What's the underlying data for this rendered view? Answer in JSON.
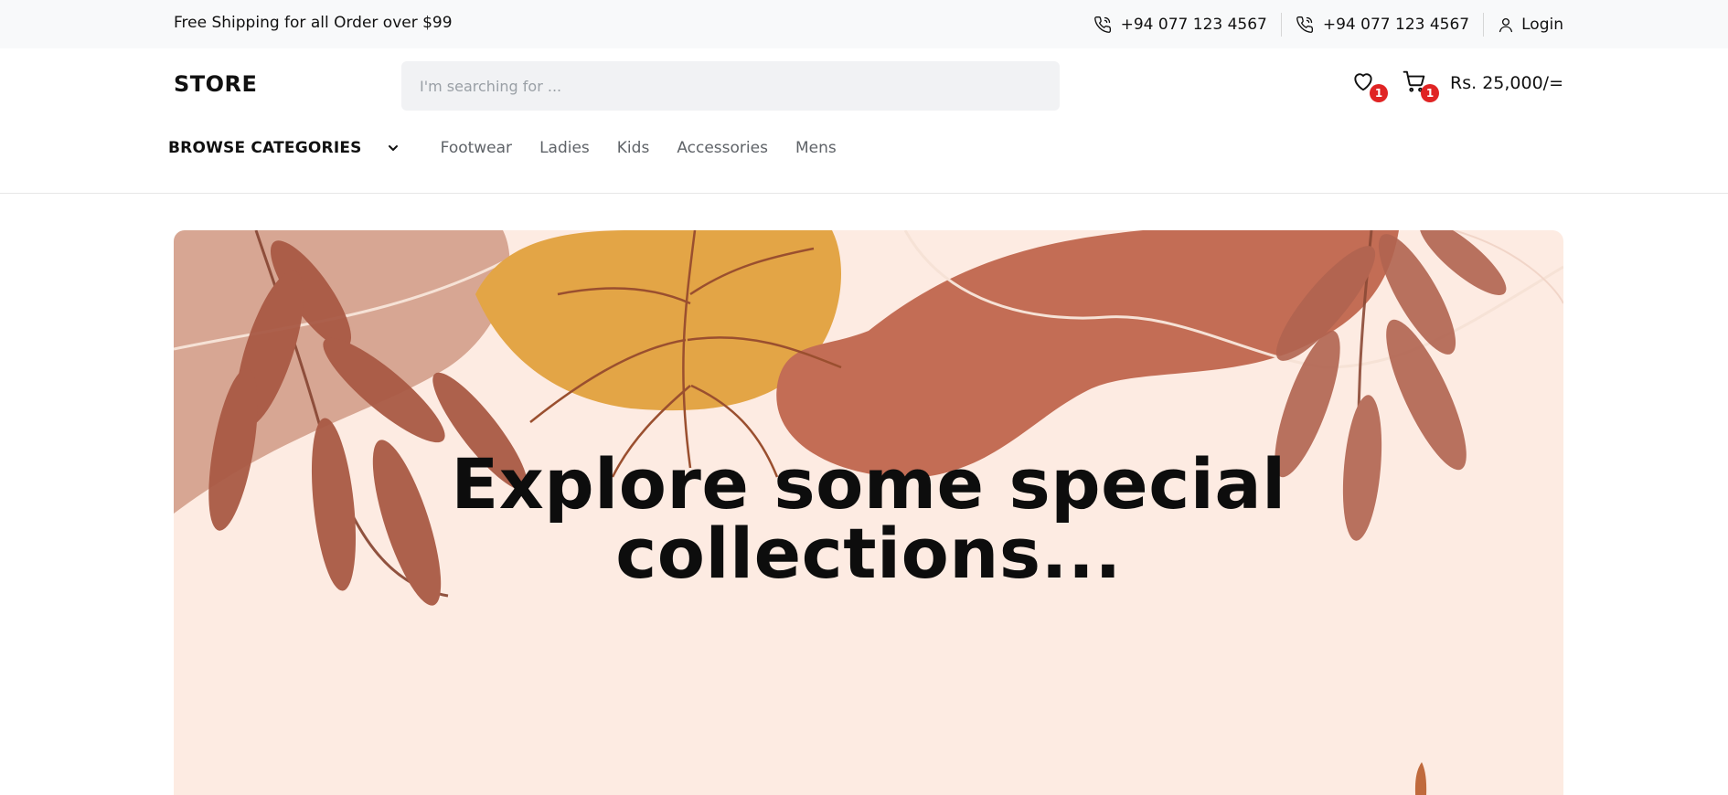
{
  "topbar": {
    "promo_text": "Free Shipping for all Order over $99",
    "phones": [
      "+94 077 123 4567",
      "+94 077 123 4567"
    ],
    "phone_icon": "phone-icon",
    "login_label": "Login",
    "login_icon": "user-icon"
  },
  "header": {
    "logo": "STORE",
    "search_placeholder": "I'm searching for ...",
    "wishlist_icon": "heart-icon",
    "wishlist_count": "1",
    "cart_icon": "cart-icon",
    "cart_count": "1",
    "cart_total": "Rs. 25,000/="
  },
  "nav": {
    "browse_label": "BROWSE CATEGORIES",
    "browse_icon": "chevron-down-icon",
    "links": [
      "Footwear",
      "Ladies",
      "Kids",
      "Accessories",
      "Mens"
    ]
  },
  "hero": {
    "headline_line1": "Explore some special",
    "headline_line2": "collections..."
  },
  "colors": {
    "topbar_bg": "#f8f9fa",
    "badge": "#e02424",
    "hero_bg": "#fdebe2",
    "terracotta": "#c0705a",
    "ochre": "#e6a94a"
  }
}
